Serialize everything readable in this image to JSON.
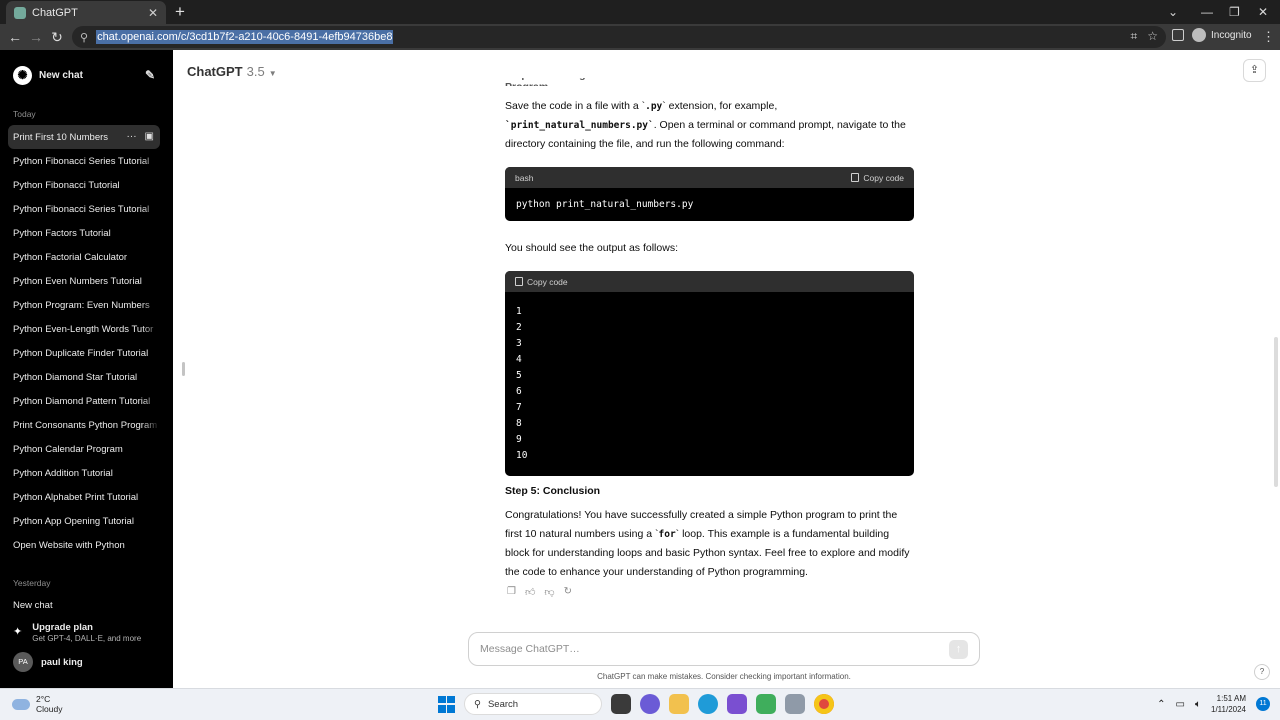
{
  "browser": {
    "tab_title": "ChatGPT",
    "url": "chat.openai.com/c/3cd1b7f2-a210-40c6-8491-4efb94736be8",
    "incognito_label": "Incognito"
  },
  "sidebar": {
    "new_chat_label": "New chat",
    "today_label": "Today",
    "items": [
      "Print First 10 Numbers",
      "Python Fibonacci Series Tutorial",
      "Python Fibonacci Tutorial",
      "Python Fibonacci Series Tutorial",
      "Python Factors Tutorial",
      "Python Factorial Calculator",
      "Python Even Numbers Tutorial",
      "Python Program: Even Numbers",
      "Python Even-Length Words Tutor",
      "Python Duplicate Finder Tutorial",
      "Python Diamond Star Tutorial",
      "Python Diamond Pattern Tutorial",
      "Print Consonants Python Program",
      "Python Calendar Program",
      "Python Addition Tutorial",
      "Python Alphabet Print Tutorial",
      "Python App Opening Tutorial",
      "Open Website with Python"
    ],
    "yesterday_label": "Yesterday",
    "yesterday_items": [
      "New chat"
    ],
    "upgrade_title": "Upgrade plan",
    "upgrade_sub": "Get GPT-4, DALL·E, and more",
    "user_initials": "PA",
    "user_name": "paul king"
  },
  "header": {
    "model_name": "ChatGPT",
    "model_version": "3.5"
  },
  "message": {
    "p1_a": "Save the code in a file with a `",
    "p1_code1": ".py",
    "p1_b": "` extension, for example,",
    "p1_code2": "`print_natural_numbers.py`",
    "p1_c": ". Open a terminal or command prompt, navigate to the directory containing the file, and run the following command:",
    "code1_lang": "bash",
    "copy_label": "Copy code",
    "code1": "python print_natural_numbers.py",
    "p2": "You should see the output as follows:",
    "output_lines": [
      "1",
      "2",
      "3",
      "4",
      "5",
      "6",
      "7",
      "8",
      "9",
      "10"
    ],
    "step_title": "Step 5: Conclusion",
    "p3_a": "Congratulations! You have successfully created a simple Python program to print the first 10 natural numbers using a `",
    "p3_code": "for",
    "p3_b": "` loop. This example is a fundamental building block for understanding loops and basic Python syntax. Feel free to explore and modify the code to enhance your understanding of Python programming."
  },
  "composer": {
    "placeholder": "Message ChatGPT…",
    "disclaimer": "ChatGPT can make mistakes. Consider checking important information."
  },
  "taskbar": {
    "temperature": "2°C",
    "weather": "Cloudy",
    "search_label": "Search",
    "time": "1:51 AM",
    "date": "1/11/2024",
    "notification_count": "11"
  }
}
